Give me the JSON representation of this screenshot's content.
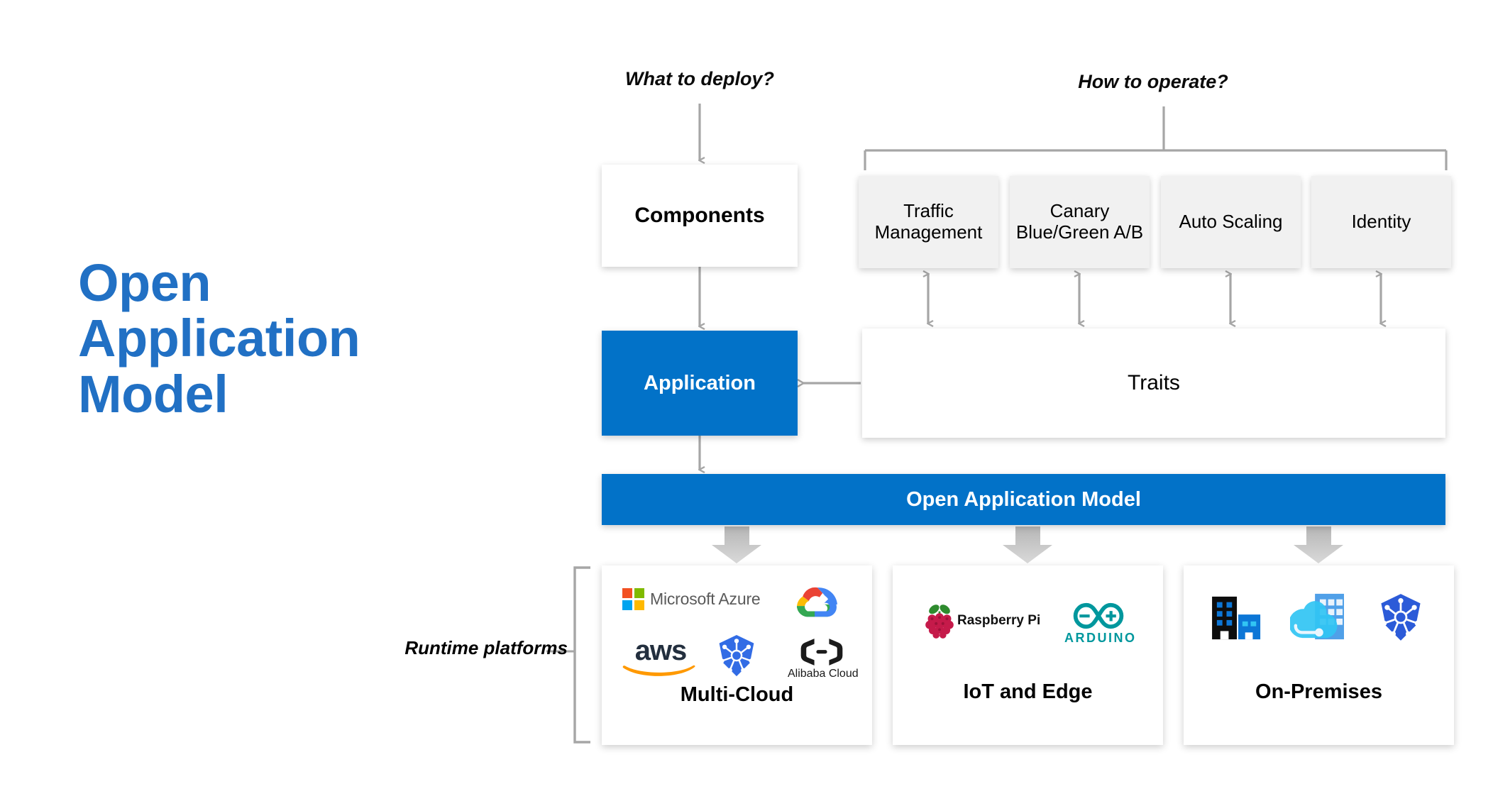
{
  "title": {
    "line1": "Open",
    "line2": "Application",
    "line3": "Model"
  },
  "labels": {
    "what_to_deploy": "What to deploy?",
    "how_to_operate": "How to operate?",
    "runtime_platforms": "Runtime platforms"
  },
  "boxes": {
    "components": "Components",
    "application": "Application",
    "traits": "Traits",
    "oam_banner": "Open Application Model"
  },
  "traits": [
    {
      "label": "Traffic Management"
    },
    {
      "label": "Canary Blue/Green A/B"
    },
    {
      "label": "Auto Scaling"
    },
    {
      "label": "Identity"
    }
  ],
  "platforms": [
    {
      "name": "Multi-Cloud",
      "logos": [
        {
          "icon": "microsoft-azure-logo",
          "text": "Microsoft Azure"
        },
        {
          "icon": "google-cloud-logo",
          "text": ""
        },
        {
          "icon": "aws-logo",
          "text": "aws"
        },
        {
          "icon": "kubernetes-logo",
          "text": ""
        },
        {
          "icon": "alibaba-cloud-logo",
          "text": "Alibaba Cloud"
        }
      ]
    },
    {
      "name": "IoT and Edge",
      "logos": [
        {
          "icon": "raspberry-pi-logo",
          "text": "Raspberry Pi"
        },
        {
          "icon": "arduino-logo",
          "text": "ARDUINO"
        }
      ]
    },
    {
      "name": "On-Premises",
      "logos": [
        {
          "icon": "datacenter-buildings-icon",
          "text": ""
        },
        {
          "icon": "azure-hybrid-cloud-icon",
          "text": ""
        },
        {
          "icon": "kubernetes-logo",
          "text": ""
        }
      ]
    }
  ],
  "colors": {
    "brand_blue": "#2170C4",
    "accent_blue": "#0272C8",
    "trait_gray": "#F1F1F1",
    "connector_gray": "#A6A6A6",
    "arrow_gray": "#BFBFBF",
    "arduino_teal": "#00979D",
    "kubernetes_blue": "#326CE5",
    "aws_orange": "#FF9900",
    "raspberry_red": "#C51A4A"
  }
}
